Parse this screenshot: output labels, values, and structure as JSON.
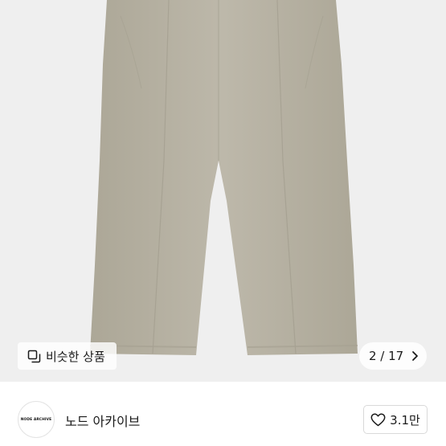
{
  "product": {
    "image_alt_colors": {
      "pants": "#b9b4a6",
      "background": "#efefef"
    }
  },
  "similar": {
    "label": "비슷한 상품",
    "icon": "similar-squares-icon"
  },
  "gallery": {
    "counter": "2 / 17",
    "next_icon": "chevron-right-icon"
  },
  "seller": {
    "logo_text": "NODE ARCHIVE",
    "name": "노드 아카이브"
  },
  "like": {
    "count": "3.1만",
    "icon": "heart-outline-icon"
  }
}
